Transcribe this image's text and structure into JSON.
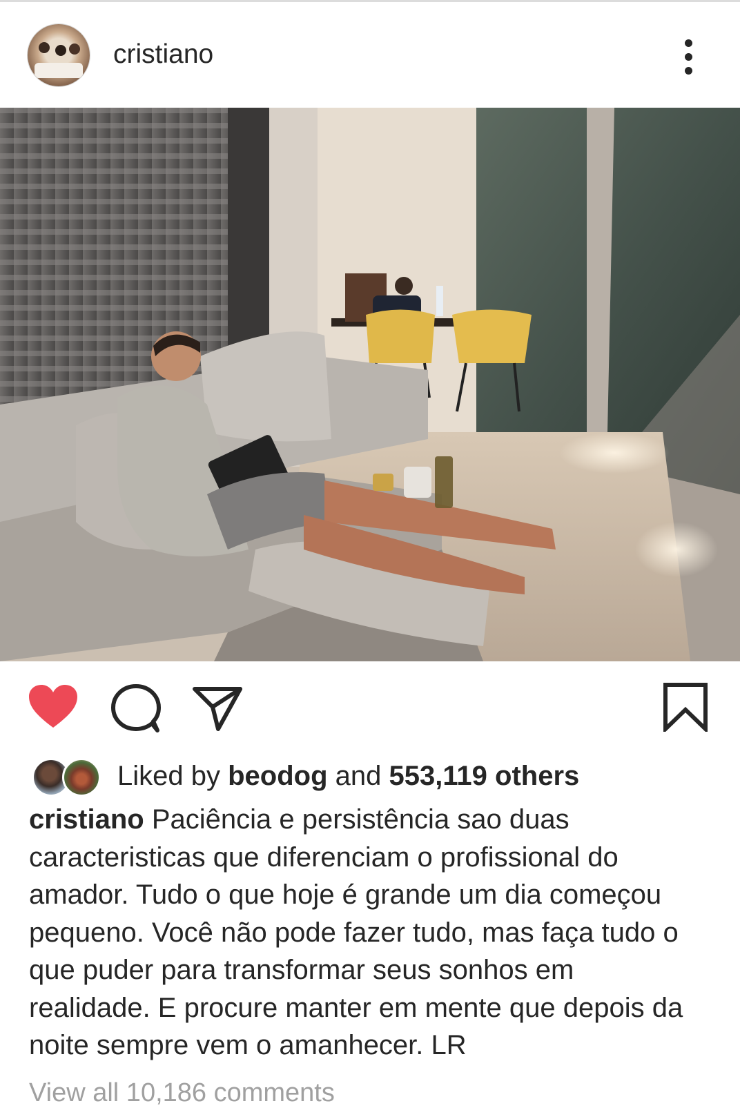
{
  "post": {
    "username": "cristiano"
  },
  "likes": {
    "prefix": "Liked by",
    "liker": "beodog",
    "joiner": "and",
    "count": "553,119 others"
  },
  "caption": {
    "username": "cristiano",
    "lines": [
      "Paciência e persistência sao duas",
      "caracteristicas que diferenciam o profissional do",
      "amador. Tudo o que hoje é grande um dia começou",
      "pequeno. Você não pode fazer tudo, mas faça tudo o",
      "que puder para transformar seus sonhos em",
      "realidade. E procure manter em mente que depois da",
      "noite sempre vem o amanhecer. LR"
    ]
  },
  "comments": {
    "view_all": "View all 10,186 comments"
  },
  "icons": {
    "like": "heart-filled-icon",
    "comment": "comment-bubble-icon",
    "share": "paper-plane-icon",
    "save": "bookmark-icon",
    "more": "more-vertical-icon"
  },
  "colors": {
    "heart": "#ed4956",
    "text": "#262626",
    "muted": "#a0a0a0"
  }
}
